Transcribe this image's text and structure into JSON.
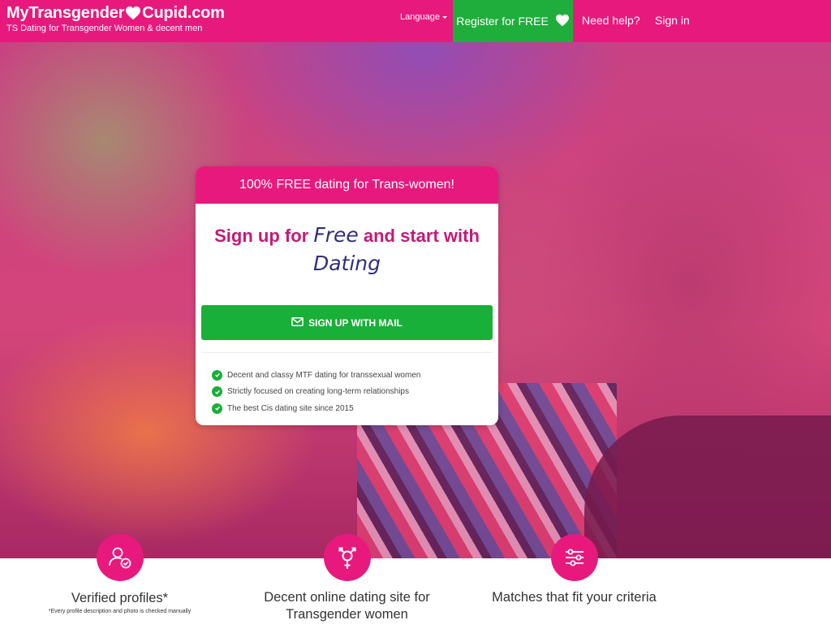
{
  "brand": {
    "title_part1": "MyTransgender",
    "title_part2": "Cupid.com",
    "tagline": "TS Dating for Transgender Women & decent men"
  },
  "nav": {
    "language_label": "Language",
    "register_label": "Register for FREE",
    "help_label": "Need help?",
    "signin_label": "Sign in"
  },
  "signup_card": {
    "header": "100% FREE dating for Trans-women!",
    "headline_part1": "Sign up for",
    "headline_free": "Free",
    "headline_part2": "and start with",
    "headline_dating": "Dating",
    "button_label": "SIGN UP WITH MAIL",
    "features": [
      "Decent and classy MTF dating for transsexual women",
      "Strictly focused on creating long-term relationships",
      "The best Cis dating site since 2015"
    ]
  },
  "features": [
    {
      "title": "Verified profiles*",
      "note": "*Every profile description and photo is checked manually",
      "icon": "verified-user-icon"
    },
    {
      "title": "Decent online dating site for Transgender women",
      "icon": "transgender-symbol-icon"
    },
    {
      "title": "Matches that fit your criteria",
      "icon": "sliders-icon"
    }
  ],
  "colors": {
    "brand_pink": "#e8197d",
    "cta_green": "#18b038",
    "headline_purple": "#c21b78",
    "script_navy": "#2f2f7a"
  }
}
